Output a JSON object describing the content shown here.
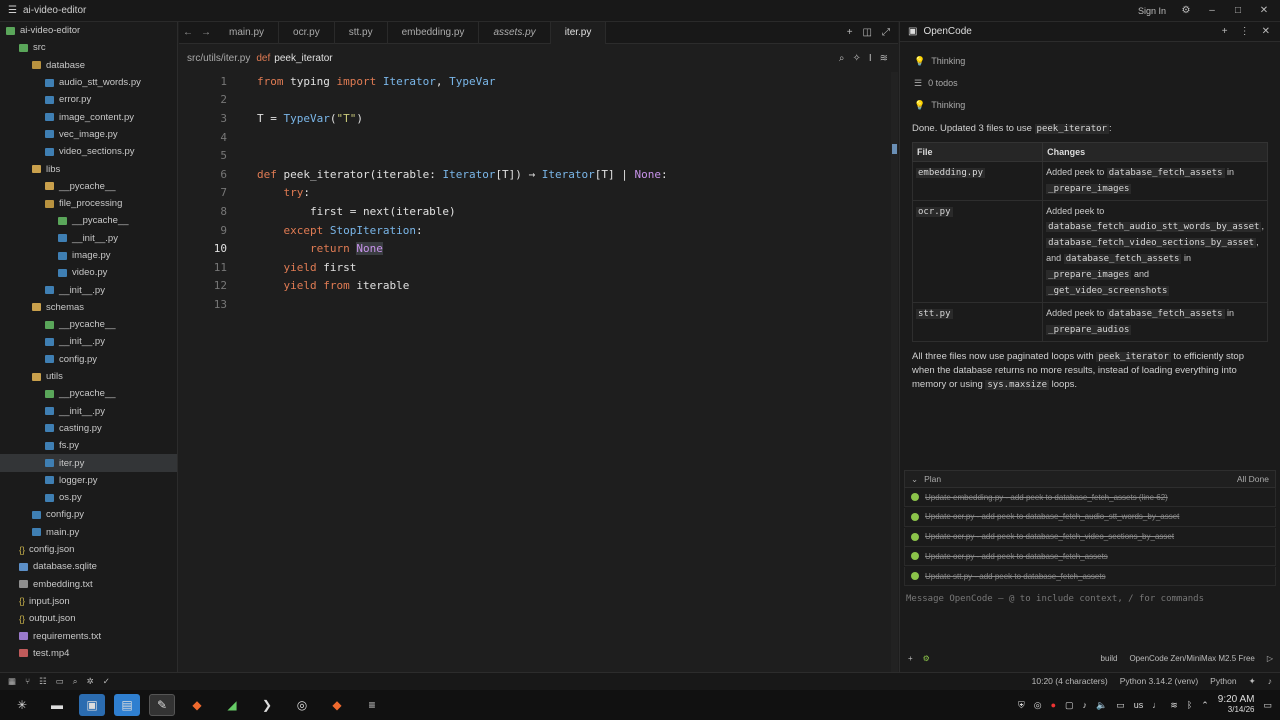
{
  "titlebar": {
    "app": "ai-video-editor",
    "signin": "Sign In"
  },
  "sidebar": {
    "items": [
      {
        "label": "ai-video-editor",
        "icon": "pyc",
        "indent": 0
      },
      {
        "label": "src",
        "icon": "pyc",
        "indent": 1
      },
      {
        "label": "database",
        "icon": "folder-open",
        "indent": 2
      },
      {
        "label": "audio_stt_words.py",
        "icon": "py",
        "indent": 3
      },
      {
        "label": "error.py",
        "icon": "py",
        "indent": 3
      },
      {
        "label": "image_content.py",
        "icon": "py",
        "indent": 3
      },
      {
        "label": "vec_image.py",
        "icon": "py",
        "indent": 3
      },
      {
        "label": "video_sections.py",
        "icon": "py",
        "indent": 3
      },
      {
        "label": "libs",
        "icon": "folder",
        "indent": 2
      },
      {
        "label": "__pycache__",
        "icon": "folder",
        "indent": 3
      },
      {
        "label": "file_processing",
        "icon": "folder-open",
        "indent": 3
      },
      {
        "label": "__pycache__",
        "icon": "pyc",
        "indent": 4
      },
      {
        "label": "__init__.py",
        "icon": "py",
        "indent": 4
      },
      {
        "label": "image.py",
        "icon": "py",
        "indent": 4
      },
      {
        "label": "video.py",
        "icon": "py",
        "indent": 4
      },
      {
        "label": "__init__.py",
        "icon": "py",
        "indent": 3
      },
      {
        "label": "schemas",
        "icon": "folder",
        "indent": 2
      },
      {
        "label": "__pycache__",
        "icon": "pyc",
        "indent": 3
      },
      {
        "label": "__init__.py",
        "icon": "py",
        "indent": 3
      },
      {
        "label": "config.py",
        "icon": "py",
        "indent": 3
      },
      {
        "label": "utils",
        "icon": "folder",
        "indent": 2
      },
      {
        "label": "__pycache__",
        "icon": "pyc",
        "indent": 3
      },
      {
        "label": "__init__.py",
        "icon": "py",
        "indent": 3
      },
      {
        "label": "casting.py",
        "icon": "py",
        "indent": 3
      },
      {
        "label": "fs.py",
        "icon": "py",
        "indent": 3
      },
      {
        "label": "iter.py",
        "icon": "py",
        "indent": 3,
        "selected": true
      },
      {
        "label": "logger.py",
        "icon": "py",
        "indent": 3
      },
      {
        "label": "os.py",
        "icon": "py",
        "indent": 3
      },
      {
        "label": "config.py",
        "icon": "py",
        "indent": 2
      },
      {
        "label": "main.py",
        "icon": "py",
        "indent": 2
      },
      {
        "label": "config.json",
        "icon": "json",
        "indent": 1
      },
      {
        "label": "database.sqlite",
        "icon": "db",
        "indent": 1
      },
      {
        "label": "embedding.txt",
        "icon": "txt",
        "indent": 1
      },
      {
        "label": "input.json",
        "icon": "json",
        "indent": 1
      },
      {
        "label": "output.json",
        "icon": "json",
        "indent": 1
      },
      {
        "label": "requirements.txt",
        "icon": "req",
        "indent": 1
      },
      {
        "label": "test.mp4",
        "icon": "mp4",
        "indent": 1
      }
    ]
  },
  "tabs": [
    {
      "label": "main.py"
    },
    {
      "label": "ocr.py"
    },
    {
      "label": "stt.py"
    },
    {
      "label": "embedding.py"
    },
    {
      "label": "assets.py",
      "italic": true
    },
    {
      "label": "iter.py",
      "active": true
    }
  ],
  "breadcrumb": {
    "path": "src/utils/iter.py",
    "kw": "def",
    "fn": "peek_iterator"
  },
  "code": [
    {
      "n": "1",
      "tokens": [
        [
          "k",
          "from"
        ],
        [
          "f",
          " typing "
        ],
        [
          "k",
          "import"
        ],
        [
          "t",
          " Iterator"
        ],
        [
          "f",
          ", "
        ],
        [
          "t",
          "TypeVar"
        ]
      ]
    },
    {
      "n": "2",
      "tokens": []
    },
    {
      "n": "3",
      "tokens": [
        [
          "f",
          "T = "
        ],
        [
          "t",
          "TypeVar"
        ],
        [
          "f",
          "("
        ],
        [
          "s",
          "\"T\""
        ],
        [
          "f",
          ")"
        ]
      ]
    },
    {
      "n": "4",
      "tokens": []
    },
    {
      "n": "5",
      "tokens": []
    },
    {
      "n": "6",
      "tokens": [
        [
          "k",
          "def"
        ],
        [
          "f",
          " peek_iterator(iterable: "
        ],
        [
          "t",
          "Iterator"
        ],
        [
          "f",
          "[T]) → "
        ],
        [
          "t",
          "Iterator"
        ],
        [
          "f",
          "[T] | "
        ],
        [
          "n",
          "None"
        ],
        [
          "f",
          ":"
        ]
      ]
    },
    {
      "n": "7",
      "tokens": [
        [
          "f",
          "    "
        ],
        [
          "k",
          "try"
        ],
        [
          "f",
          ":"
        ]
      ]
    },
    {
      "n": "8",
      "tokens": [
        [
          "f",
          "        first = next(iterable)"
        ]
      ]
    },
    {
      "n": "9",
      "tokens": [
        [
          "f",
          "    "
        ],
        [
          "k",
          "except"
        ],
        [
          "t",
          " StopIteration"
        ],
        [
          "f",
          ":"
        ]
      ]
    },
    {
      "n": "10",
      "current": true,
      "tokens": [
        [
          "f",
          "        "
        ],
        [
          "k",
          "return"
        ],
        [
          "f",
          " "
        ],
        [
          "nhl",
          "None"
        ]
      ]
    },
    {
      "n": "11",
      "tokens": [
        [
          "f",
          "    "
        ],
        [
          "k",
          "yield"
        ],
        [
          "f",
          " first"
        ]
      ]
    },
    {
      "n": "12",
      "tokens": [
        [
          "f",
          "    "
        ],
        [
          "k",
          "yield"
        ],
        [
          "f",
          " "
        ],
        [
          "k",
          "from"
        ],
        [
          "f",
          " iterable"
        ]
      ]
    },
    {
      "n": "13",
      "tokens": []
    }
  ],
  "panel": {
    "title": "OpenCode",
    "thinking1": "Thinking",
    "todos": "0 todos",
    "thinking2": "Thinking",
    "done_prefix": "Done. Updated 3 files to use ",
    "done_code": "peek_iterator",
    "done_suffix": ":",
    "table_head": {
      "file": "File",
      "changes": "Changes"
    },
    "rows": [
      {
        "file": "embedding.py",
        "parts": [
          [
            "t",
            "Added peek to "
          ],
          [
            "c",
            "database_fetch_assets"
          ],
          [
            "t",
            " in "
          ],
          [
            "c",
            "_prepare_images"
          ]
        ]
      },
      {
        "file": "ocr.py",
        "parts": [
          [
            "t",
            "Added peek to "
          ],
          [
            "c",
            "database_fetch_audio_stt_words_by_asset"
          ],
          [
            "t",
            ", "
          ],
          [
            "c",
            "database_fetch_video_sections_by_asset"
          ],
          [
            "t",
            ", and "
          ],
          [
            "c",
            "database_fetch_assets"
          ],
          [
            "t",
            " in "
          ],
          [
            "c",
            "_prepare_images"
          ],
          [
            "t",
            " and "
          ],
          [
            "c",
            "_get_video_screenshots"
          ]
        ]
      },
      {
        "file": "stt.py",
        "parts": [
          [
            "t",
            "Added peek to "
          ],
          [
            "c",
            "database_fetch_assets"
          ],
          [
            "t",
            " in "
          ],
          [
            "c",
            "_prepare_audios"
          ]
        ]
      }
    ],
    "summary_parts": [
      [
        "t",
        "All three files now use paginated loops with "
      ],
      [
        "c",
        "peek_iterator"
      ],
      [
        "t",
        " to efficiently stop when the database returns no more results, instead of loading everything into memory or using "
      ],
      [
        "c",
        "sys.maxsize"
      ],
      [
        "t",
        " loops."
      ]
    ],
    "plan_label": "Plan",
    "plan_status": "All Done",
    "plan": [
      "Update embedding.py - add peek to database_fetch_assets (line 62)",
      "Update ocr.py - add peek to database_fetch_audio_stt_words_by_asset",
      "Update ocr.py - add peek to database_fetch_video_sections_by_asset",
      "Update ocr.py - add peek to database_fetch_assets",
      "Update stt.py - add peek to database_fetch_assets"
    ],
    "input_placeholder": "Message OpenCode — @ to include context, / for commands",
    "footer": {
      "mode": "build",
      "model": "OpenCode Zen/MiniMax M2.5 Free"
    }
  },
  "status": {
    "pos": "10:20 (4 characters)",
    "env": "Python 3.14.2 (venv)",
    "lang": "Python"
  },
  "tray": {
    "lang": "us",
    "time": "9:20 AM",
    "date": "3/14/26"
  }
}
